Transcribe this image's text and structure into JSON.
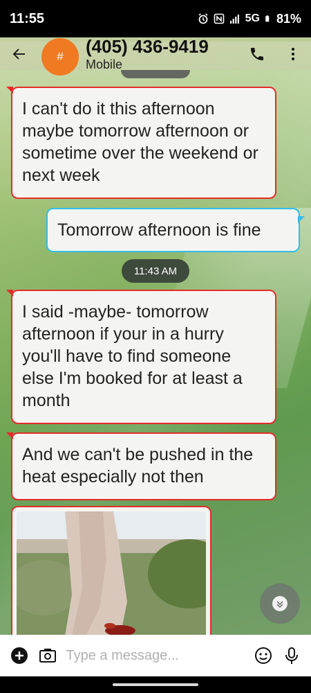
{
  "status_bar": {
    "time": "11:55",
    "network": "5G",
    "battery": "81%",
    "icons": [
      "alarm-icon",
      "nfc-icon",
      "signal-icon",
      "battery-icon"
    ]
  },
  "header": {
    "avatar_letter": "#",
    "contact_name": "(405) 436-9419",
    "contact_type": "Mobile",
    "avatar_color": "#f07a21"
  },
  "messages": [
    {
      "direction": "incoming",
      "text": "I can't do it this afternoon maybe tomorrow afternoon or sometime over the weekend or next week"
    },
    {
      "direction": "outgoing",
      "text": "Tomorrow afternoon is fine"
    },
    {
      "direction": "incoming",
      "text": "I said -maybe- tomorrow afternoon if your in a hurry you'll have to find someone else I'm booked for at least a month"
    },
    {
      "direction": "incoming",
      "text": "And we can't be pushed in the heat especially not then"
    }
  ],
  "timestamp": "11:43 AM",
  "compose": {
    "placeholder": "Type a message..."
  },
  "colors": {
    "incoming_border": "#e52b2b",
    "outgoing_border": "#33bde8"
  }
}
